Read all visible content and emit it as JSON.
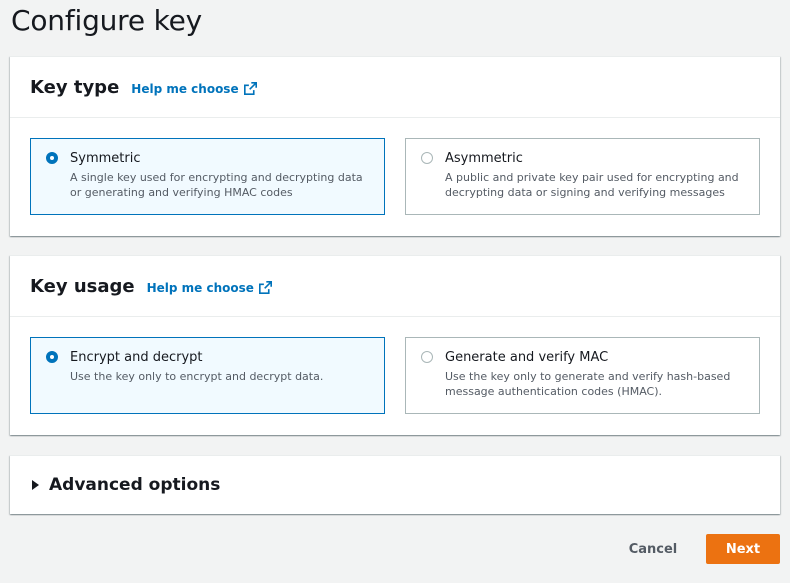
{
  "page": {
    "title": "Configure key"
  },
  "key_type": {
    "heading": "Key type",
    "help_link": "Help me choose",
    "options": [
      {
        "title": "Symmetric",
        "description": "A single key used for encrypting and decrypting data or generating and verifying HMAC codes",
        "selected": true
      },
      {
        "title": "Asymmetric",
        "description": "A public and private key pair used for encrypting and decrypting data or signing and verifying messages",
        "selected": false
      }
    ]
  },
  "key_usage": {
    "heading": "Key usage",
    "help_link": "Help me choose",
    "options": [
      {
        "title": "Encrypt and decrypt",
        "description": "Use the key only to encrypt and decrypt data.",
        "selected": true
      },
      {
        "title": "Generate and verify MAC",
        "description": "Use the key only to generate and verify hash-based message authentication codes (HMAC).",
        "selected": false
      }
    ]
  },
  "advanced": {
    "label": "Advanced options",
    "expanded": false
  },
  "actions": {
    "cancel_label": "Cancel",
    "next_label": "Next"
  },
  "colors": {
    "accent": "#0073bb",
    "primary_button": "#ec7211",
    "selected_tile_bg": "#f1faff",
    "background": "#f2f3f3"
  },
  "icons": {
    "help_link_icon": "external-link-icon",
    "advanced_toggle_icon": "caret-right-icon"
  }
}
